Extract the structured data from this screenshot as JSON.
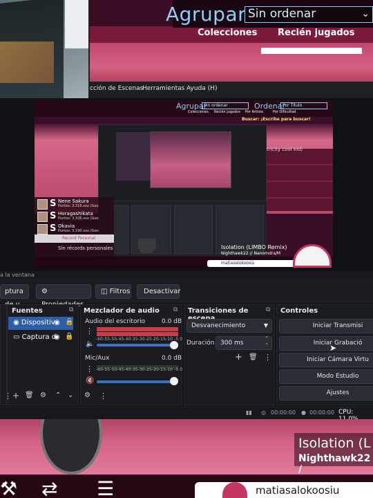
{
  "osu": {
    "group_label": "Agrupar",
    "sort_value": "Sin ordenar",
    "tabs": [
      "Colecciones",
      "Recién jugados"
    ],
    "song_title": "Isolation (L",
    "song_artist": "Nighthawk22 /",
    "player_name": "matiasalokoosiu"
  },
  "obs": {
    "menu": [
      "cción de Escenas",
      "Herramientas",
      "Ayuda (H)"
    ],
    "hint": "a la ventana",
    "toolbar": {
      "capture": "ptura de v",
      "properties": "Propiedades",
      "filters": "Filtros",
      "deactivate": "Desactivar"
    },
    "sources": {
      "title": "Fuentes",
      "items": [
        "Dispositiv",
        "Captura d"
      ]
    },
    "mixer": {
      "title": "Mezclador de audio",
      "channels": [
        {
          "name": "Audio del escritorio",
          "db": "0.0 dB"
        },
        {
          "name": "Mic/Aux",
          "db": "0.0 dB"
        }
      ],
      "ticks": "-60-55-50-45-40-35-30-25-20-15-10 -5  0"
    },
    "transitions": {
      "title": "Transiciones de escena",
      "selected": "Desvanecimiento",
      "duration_label": "Duración",
      "duration_value": "300 ms"
    },
    "controls": {
      "title": "Controles",
      "buttons": [
        "Iniciar Transmisi",
        "Iniciar Grabació",
        "Iniciar Cámara Virtu",
        "Modo Estudio",
        "Ajustes"
      ]
    },
    "status": {
      "stream_time": "00:00:00",
      "rec_time": "00:00:00",
      "cpu": "CPU: 11.0%"
    }
  },
  "preview": {
    "group_label": "Agrupar",
    "group_value": "Sin ordenar",
    "sort_label": "Ordenar",
    "sort_value": "Por Título",
    "tabs": [
      "Colecciones",
      "Recién jugados",
      "Por Artista",
      "Por Dificultad"
    ],
    "search": "Buscar: ¡Escribe para buscar!",
    "row_text": "ctricity cool kid)",
    "scores": [
      {
        "name": "Nene Sakura",
        "points": "Puntos: 3.316.xxx (Goo"
      },
      {
        "name": "Horagashikata",
        "points": "Puntos: 3.326.xxx (Goo"
      },
      {
        "name": "Okavia",
        "points": "Puntos: 3.190.xxx (Goo"
      }
    ],
    "record_label": "Record Personal",
    "no_records": "Sin récords personales",
    "song": "Isolation (LIMBO Remix)",
    "artist": "Nighthawk22 // Nanomdra/M",
    "player": "matiasalokoosiu"
  },
  "colors": {
    "accent_blue": "#2f5ea8",
    "osu_pink": "#d36284",
    "osu_blue_text": "#8fd0f4",
    "meter_red": "#c63d4c"
  }
}
